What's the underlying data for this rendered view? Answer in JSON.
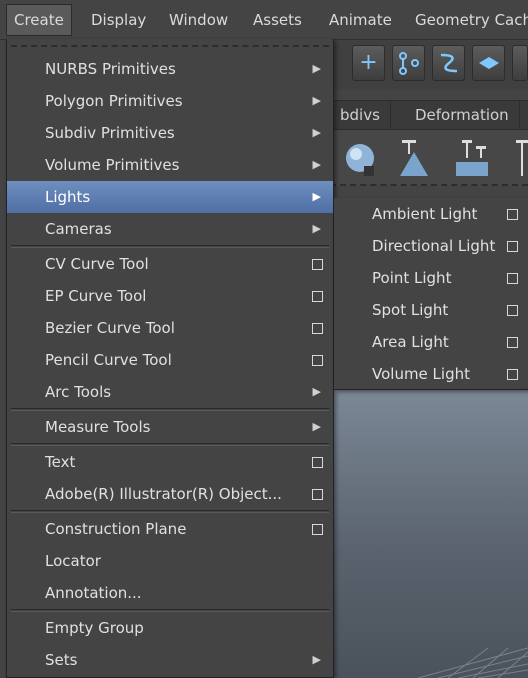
{
  "menubar": {
    "items": [
      {
        "label": "Create",
        "active": true
      },
      {
        "label": "Display"
      },
      {
        "label": "Window"
      },
      {
        "label": "Assets"
      },
      {
        "label": "Animate"
      },
      {
        "label": "Geometry Cach"
      }
    ]
  },
  "shelf": {
    "icons": [
      "plus-icon",
      "joint-icon",
      "curve-icon",
      "plane-icon"
    ],
    "tabs": [
      "bdivs",
      "Deformation"
    ]
  },
  "create_menu": {
    "items": [
      {
        "label": "NURBS Primitives",
        "type": "submenu"
      },
      {
        "label": "Polygon Primitives",
        "type": "submenu"
      },
      {
        "label": "Subdiv Primitives",
        "type": "submenu"
      },
      {
        "label": "Volume Primitives",
        "type": "submenu"
      },
      {
        "label": "Lights",
        "type": "submenu",
        "highlighted": true
      },
      {
        "label": "Cameras",
        "type": "submenu"
      },
      {
        "label": "CV Curve Tool",
        "type": "option"
      },
      {
        "label": "EP Curve Tool",
        "type": "option"
      },
      {
        "label": "Bezier Curve Tool",
        "type": "option"
      },
      {
        "label": "Pencil Curve Tool",
        "type": "option"
      },
      {
        "label": "Arc Tools",
        "type": "submenu"
      },
      {
        "label": "Measure Tools",
        "type": "submenu"
      },
      {
        "label": "Text",
        "type": "option"
      },
      {
        "label": "Adobe(R) Illustrator(R) Object...",
        "type": "option"
      },
      {
        "label": "Construction Plane",
        "type": "option"
      },
      {
        "label": "Locator",
        "type": "plain"
      },
      {
        "label": "Annotation...",
        "type": "plain"
      },
      {
        "label": "Empty Group",
        "type": "plain"
      },
      {
        "label": "Sets",
        "type": "submenu"
      }
    ]
  },
  "lights_submenu": {
    "items": [
      {
        "label": "Ambient Light"
      },
      {
        "label": "Directional Light"
      },
      {
        "label": "Point Light"
      },
      {
        "label": "Spot Light"
      },
      {
        "label": "Area Light"
      },
      {
        "label": "Volume Light"
      }
    ]
  },
  "colors": {
    "menu_bg": "#444444",
    "highlight": "#5f7fb2",
    "text": "#e0e0e0"
  }
}
